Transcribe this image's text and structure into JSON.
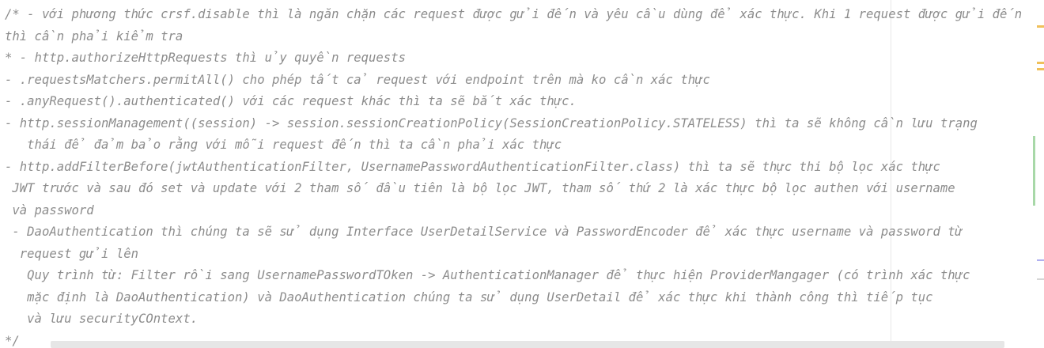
{
  "editor": {
    "lines": [
      "/* - với phương thức crsf.disable thì là ngăn chặn các request được gửi đến và yêu cầu dùng để xác thực. Khi 1 request được gửi đến",
      "thì cần phải kiểm tra",
      "* - http.authorizeHttpRequests thì ủy quyền requests",
      "- .requestsMatchers.permitAll() cho phép tất cả request với endpoint trên mà ko cần xác thực",
      "- .anyRequest().authenticated() với các request khác thì ta sẽ bắt xác thực.",
      "- http.sessionManagement((session) -> session.sessionCreationPolicy(SessionCreationPolicy.STATELESS) thì ta sẽ không cần lưu trạng",
      "   thái để đảm bảo rằng với mỗi request đến thì ta cần phải xác thực",
      "- http.addFilterBefore(jwtAuthenticationFilter, UsernamePasswordAuthenticationFilter.class) thì ta sẽ thực thi bộ lọc xác thực",
      " JWT trước và sau đó set và update với 2 tham số đầu tiên là bộ lọc JWT, tham số thứ 2 là xác thực bộ lọc authen với username",
      " và password",
      " - DaoAuthentication thì chúng ta sẽ sử dụng Interface UserDetailService và PasswordEncoder để xác thực username và password từ",
      "  request gửi lên",
      "   Quy trình từ: Filter rồi sang UsernamePasswordTOken -> AuthenticationManager để thực hiện ProviderMangager (có trình xác thực",
      "   mặc định là DaoAuthentication) và DaoAuthentication chúng ta sử dụng UserDetail để xác thực khi thành công thì tiếp tục",
      "   và lưu securityCOntext.",
      "*/"
    ]
  },
  "colors": {
    "comment_text": "#8c8c8c",
    "background": "#ffffff",
    "warning_marker": "#f0c05a",
    "vcs_changed_marker": "#a8d8a8",
    "info_marker": "#b0b0f0"
  }
}
